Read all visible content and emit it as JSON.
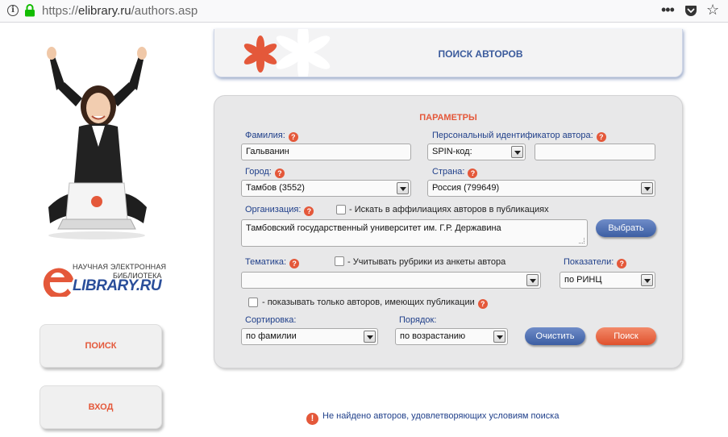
{
  "browser": {
    "url_prefix": "https://",
    "url_host": "elibrary.ru",
    "url_path": "/authors.asp",
    "menu_glyph": "•••",
    "star_glyph": "☆"
  },
  "logo": {
    "line1": "НАУЧНАЯ ЭЛЕКТРОННАЯ",
    "line2": "БИБЛИОТЕКА",
    "main": "LIBRARY.RU"
  },
  "sidebar": {
    "search_label": "ПОИСК",
    "login_label": "ВХОД"
  },
  "banner": {
    "title": "ПОИСК АВТОРОВ"
  },
  "form": {
    "title": "ПАРАМЕТРЫ",
    "help_glyph": "?",
    "surname": {
      "label": "Фамилия:",
      "value": "Гальванин"
    },
    "personal_id": {
      "label": "Персональный идентификатор автора:",
      "type_value": "SPIN-код:",
      "value": ""
    },
    "city": {
      "label": "Город:",
      "value": "Тамбов  (3552)"
    },
    "country": {
      "label": "Страна:",
      "value": "Россия  (799649)"
    },
    "organization": {
      "label": "Организация:",
      "affil_checkbox_label": "- Искать в аффилиациях авторов в публикациях",
      "value": "Тамбовский государственный университет им. Г.Р. Державина",
      "select_button": "Выбрать"
    },
    "topic": {
      "label": "Тематика:",
      "rubric_checkbox_label": "- Учитывать рубрики из анкеты автора",
      "value": ""
    },
    "indicators": {
      "label": "Показатели:",
      "value": "по РИНЦ"
    },
    "only_with_pubs_label": "- показывать только авторов, имеющих публикации",
    "sort": {
      "label": "Сортировка:",
      "value": "по фамилии"
    },
    "order": {
      "label": "Порядок:",
      "value": "по возрастанию"
    },
    "clear_button": "Очистить",
    "search_button": "Поиск"
  },
  "message": {
    "icon_glyph": "!",
    "text": "Не найдено авторов, удовлетворяющих условиям поиска"
  },
  "colors": {
    "accent": "#e4583a",
    "label_blue": "#1f3f8a",
    "banner_title": "#3a5a9c"
  }
}
